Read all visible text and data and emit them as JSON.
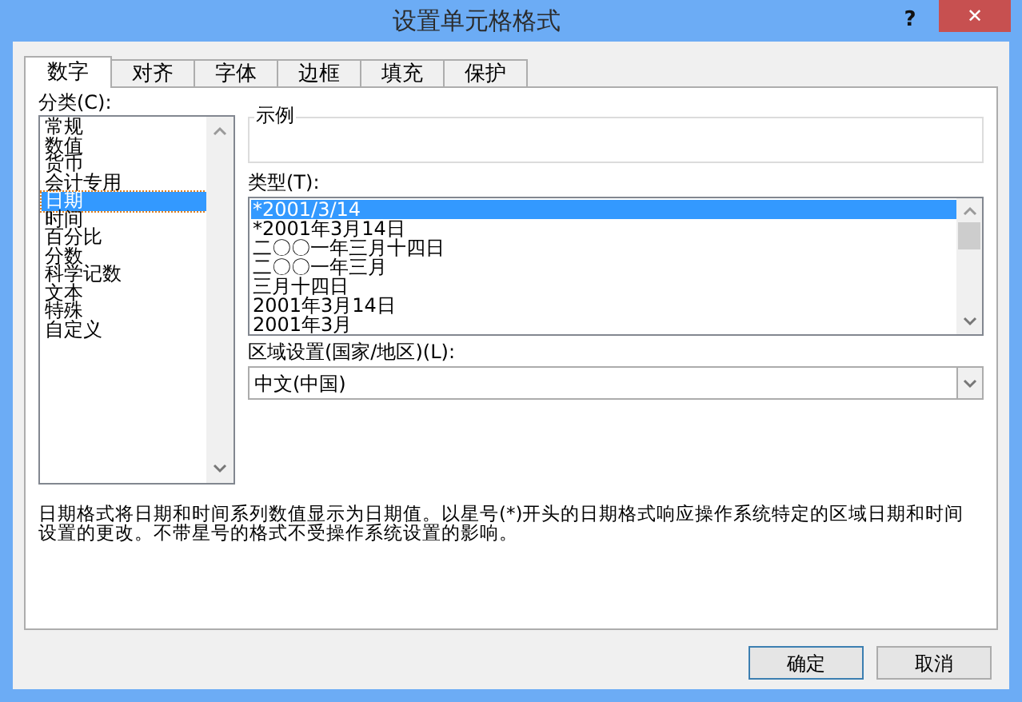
{
  "window": {
    "title": "设置单元格格式",
    "help": "?",
    "close": "✕"
  },
  "tabs": [
    {
      "label": "数字",
      "selected": true
    },
    {
      "label": "对齐",
      "selected": false
    },
    {
      "label": "字体",
      "selected": false
    },
    {
      "label": "边框",
      "selected": false
    },
    {
      "label": "填充",
      "selected": false
    },
    {
      "label": "保护",
      "selected": false
    }
  ],
  "category": {
    "label": "分类(C):",
    "items": [
      {
        "label": "常规",
        "selected": false
      },
      {
        "label": "数值",
        "selected": false
      },
      {
        "label": "货币",
        "selected": false
      },
      {
        "label": "会计专用",
        "selected": false
      },
      {
        "label": "日期",
        "selected": true
      },
      {
        "label": "时间",
        "selected": false
      },
      {
        "label": "百分比",
        "selected": false
      },
      {
        "label": "分数",
        "selected": false
      },
      {
        "label": "科学记数",
        "selected": false
      },
      {
        "label": "文本",
        "selected": false
      },
      {
        "label": "特殊",
        "selected": false
      },
      {
        "label": "自定义",
        "selected": false
      }
    ]
  },
  "sample": {
    "label": "示例"
  },
  "type": {
    "label": "类型(T):",
    "items": [
      {
        "label": "*2001/3/14",
        "selected": true
      },
      {
        "label": "*2001年3月14日",
        "selected": false
      },
      {
        "label": "二〇〇一年三月十四日",
        "selected": false
      },
      {
        "label": "二〇〇一年三月",
        "selected": false
      },
      {
        "label": "三月十四日",
        "selected": false
      },
      {
        "label": "2001年3月14日",
        "selected": false
      },
      {
        "label": "2001年3月",
        "selected": false
      }
    ]
  },
  "locale": {
    "label": "区域设置(国家/地区)(L):",
    "value": "中文(中国)"
  },
  "description": "日期格式将日期和时间系列数值显示为日期值。以星号(*)开头的日期格式响应操作系统特定的区域日期和时间设置的更改。不带星号的格式不受操作系统设置的影响。",
  "buttons": [
    {
      "label": "确定",
      "focused": true
    },
    {
      "label": "取消",
      "focused": false
    }
  ]
}
